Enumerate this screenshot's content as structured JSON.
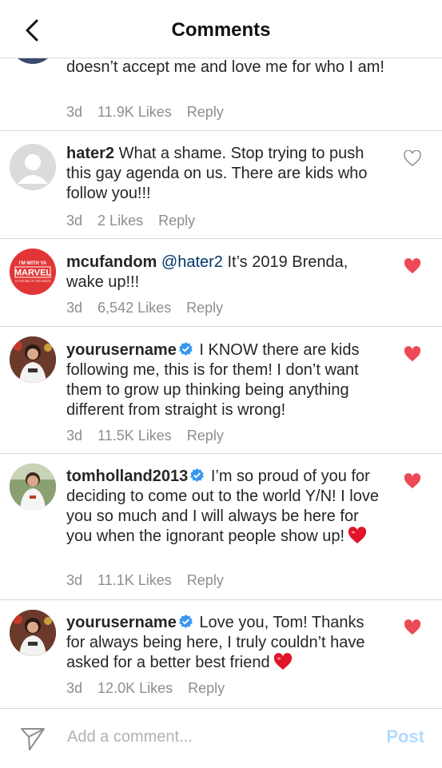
{
  "header": {
    "title": "Comments"
  },
  "comments": [
    {
      "text": "doesn’t accept me and love me for who I am!",
      "time": "3d",
      "likes": "11.9K Likes",
      "reply": "Reply"
    },
    {
      "username": "hater2",
      "text": " What a shame. Stop trying to push this gay agenda on us. There are kids who follow you!!!",
      "time": "3d",
      "likes": "2 Likes",
      "reply": "Reply"
    },
    {
      "username": "mcufandom",
      "mention": "@hater2",
      "text": " It’s 2019 Brenda, wake up!!!",
      "time": "3d",
      "likes": "6,542 Likes",
      "reply": "Reply",
      "avatar_text": {
        "top": "I'M WITH YA",
        "brand": "MARVEL",
        "bottom": "TO THE END OF THE EVENTS"
      }
    },
    {
      "username": "yourusername",
      "text": " I KNOW there are kids following me, this is for them! I don’t want them to grow up thinking being anything different from straight is wrong!",
      "time": "3d",
      "likes": "11.5K Likes",
      "reply": "Reply"
    },
    {
      "username": "tomholland2013",
      "text": " I’m so proud of you for deciding to come out to the world Y/N! I love you so much and I will always be here for you when the ignorant people show up!",
      "time": "3d",
      "likes": "11.1K Likes",
      "reply": "Reply"
    },
    {
      "username": "yourusername",
      "text": " Love you, Tom! Thanks for always being here, I truly couldn’t have asked for a better best friend",
      "time": "3d",
      "likes": "12.0K Likes",
      "reply": "Reply"
    }
  ],
  "footer": {
    "placeholder": "Add a comment...",
    "post_label": "Post"
  },
  "colors": {
    "liked": "#ed4956",
    "verified": "#3897f0",
    "post_disabled": "#b3dbff",
    "muted": "#8e8e8e"
  },
  "icons": {
    "back": "chevron-left-icon",
    "like": "heart-icon",
    "send": "paper-plane-icon",
    "verified": "verified-badge-icon"
  }
}
